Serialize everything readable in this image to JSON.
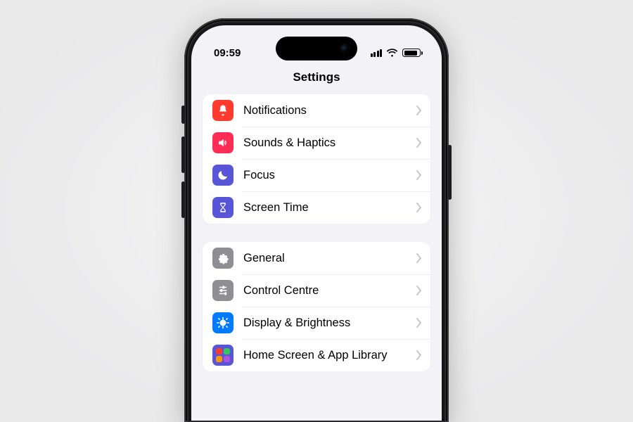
{
  "status": {
    "time": "09:59"
  },
  "title": "Settings",
  "sections": [
    {
      "id": "alerts",
      "items": [
        {
          "key": "notifications",
          "label": "Notifications"
        },
        {
          "key": "sounds",
          "label": "Sounds & Haptics"
        },
        {
          "key": "focus",
          "label": "Focus"
        },
        {
          "key": "screentime",
          "label": "Screen Time"
        }
      ]
    },
    {
      "id": "system",
      "items": [
        {
          "key": "general",
          "label": "General"
        },
        {
          "key": "controlcentre",
          "label": "Control Centre"
        },
        {
          "key": "display",
          "label": "Display & Brightness"
        },
        {
          "key": "homescreen",
          "label": "Home Screen & App Library"
        }
      ]
    }
  ],
  "colors": {
    "red": "#ff3b30",
    "pink": "#ff2d55",
    "indigo": "#5856d6",
    "gray": "#8e8e93",
    "blue": "#007aff"
  }
}
